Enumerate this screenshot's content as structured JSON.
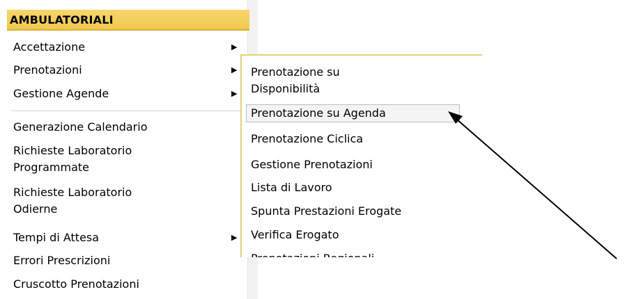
{
  "section": {
    "title": "AMBULATORIALI"
  },
  "menu": {
    "items": [
      {
        "label": "Accettazione",
        "has_submenu": true
      },
      {
        "label": "Prenotazioni",
        "has_submenu": true
      },
      {
        "label": "Gestione Agende",
        "has_submenu": true
      },
      {
        "label": "Generazione Calendario",
        "has_submenu": false
      },
      {
        "label_line1": "Richieste Laboratorio",
        "label_line2": "Programmate",
        "has_submenu": false
      },
      {
        "label_line1": "Richieste Laboratorio",
        "label_line2": "Odierne",
        "has_submenu": false
      },
      {
        "label": "Tempi di Attesa",
        "has_submenu": true
      },
      {
        "label": "Errori Prescrizioni",
        "has_submenu": false
      },
      {
        "label": "Cruscotto Prenotazioni",
        "has_submenu": false
      }
    ],
    "arrow_glyph": "▶"
  },
  "submenu": {
    "items": [
      {
        "label_line1": "Prenotazione su",
        "label_line2": "Disponibilità"
      },
      {
        "label": "Prenotazione su Agenda",
        "highlighted": true
      },
      {
        "label": "Prenotazione Ciclica"
      },
      {
        "label": "Gestione Prenotazioni"
      },
      {
        "label": "Lista di Lavoro"
      },
      {
        "label": "Spunta Prestazioni Erogate"
      },
      {
        "label": "Verifica Erogato"
      },
      {
        "label": "Prenotazioni Regionali"
      }
    ]
  },
  "colors": {
    "header_bg": "#f0c850",
    "header_border": "#e0ad2c",
    "submenu_border": "#e6cf7a",
    "highlight_bg": "#f4f4f4"
  },
  "annotation": {
    "type": "pointer-arrow",
    "points_to": "Prenotazione su Agenda"
  }
}
